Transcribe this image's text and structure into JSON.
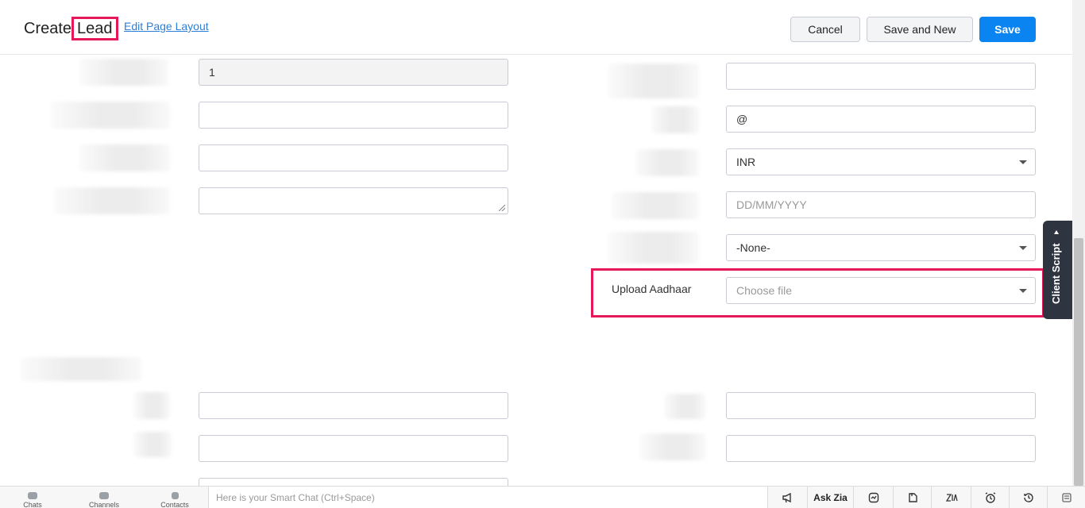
{
  "header": {
    "title_prefix": "Create",
    "title_module": "Lead",
    "edit_layout_link": "Edit Page Layout",
    "cancel_label": "Cancel",
    "save_and_new_label": "Save and New",
    "save_label": "Save"
  },
  "form": {
    "left_fields": [
      {
        "value": "1",
        "readonly": true
      },
      {
        "value": ""
      },
      {
        "value": ""
      },
      {
        "value": "",
        "type": "textarea"
      }
    ],
    "right_fields": [
      {
        "value": ""
      },
      {
        "value": "@"
      },
      {
        "value": "INR",
        "type": "select"
      },
      {
        "placeholder": "DD/MM/YYYY"
      },
      {
        "value": "-None-",
        "type": "select"
      }
    ],
    "upload": {
      "label": "Upload Aadhaar",
      "placeholder": "Choose file"
    },
    "section2_left_fields": [
      {
        "value": ""
      },
      {
        "value": ""
      }
    ],
    "section2_right_fields": [
      {
        "value": ""
      },
      {
        "value": ""
      }
    ]
  },
  "client_script_tab": "Client Script",
  "bottom_bar": {
    "chats": "Chats",
    "channels": "Channels",
    "contacts": "Contacts",
    "smart_chat_placeholder": "Here is your Smart Chat (Ctrl+Space)",
    "ask_zia": "Ask Zia",
    "icons": [
      "megaphone-icon",
      "zia-icon",
      "pen-icon",
      "zia-logo-icon",
      "alarm-icon",
      "history-icon",
      "notes-icon"
    ]
  },
  "colors": {
    "primary": "#0a84f0",
    "highlight": "#e5195a",
    "link": "#2c7fd8"
  }
}
